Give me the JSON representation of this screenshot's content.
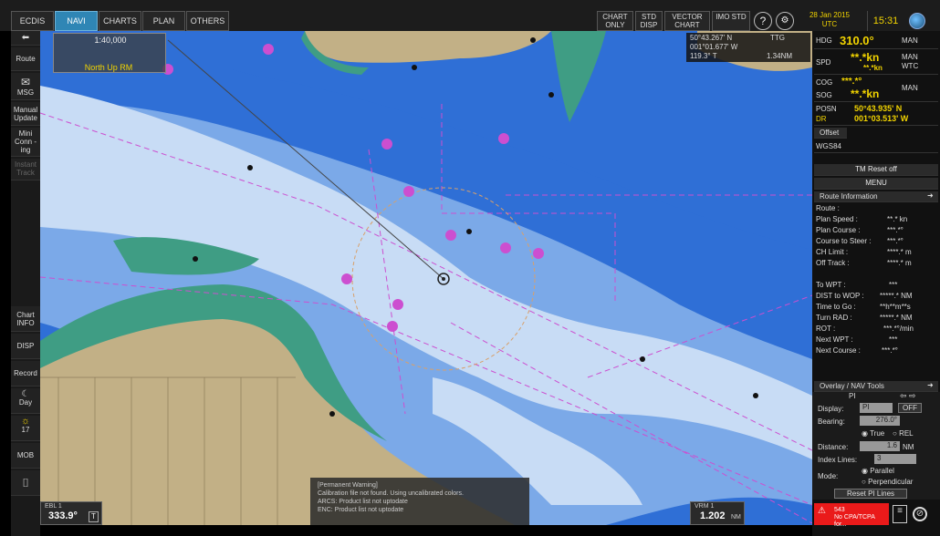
{
  "colors": {
    "deep": "#2f6fd6",
    "mid": "#7ba9e8",
    "shallow": "#c8dcf5",
    "land": "#c2b086",
    "drying": "#3f9d84",
    "symbol": "#cc4fd0",
    "accent": "#f2d400"
  },
  "tabs": [
    "ECDIS",
    "NAVI",
    "CHARTS",
    "PLAN",
    "OTHERS"
  ],
  "active_tab": "NAVI",
  "toolbar": {
    "chart_only": "CHART ONLY",
    "std_disp": "STD DISP",
    "vector_chart": "VECTOR CHART",
    "imo_std": "IMO STD",
    "help": "?",
    "date": "28 Jan 2015",
    "utc": "UTC",
    "time": "15:31"
  },
  "left": {
    "back": "⬅",
    "route": "Route",
    "msg": "MSG",
    "manual_update": "Manual Update",
    "mini_conning": "Mini Conn -ing",
    "instant_track": "Instant Track",
    "chart_info": "Chart INFO",
    "disp": "DISP",
    "record": "Record",
    "day": "Day",
    "brightness": "17",
    "mob": "MOB"
  },
  "chart": {
    "scale": "1:40,000",
    "orientation": "North Up RM",
    "target_lat": "50°43.267' N",
    "target_lon": "001°01.677' W",
    "target_brg": "119.3° T",
    "target_rng": "1.34NM",
    "ttg_label": "TTG"
  },
  "own_ship": {
    "hdg_label": "HDG",
    "hdg": "310.0°",
    "hdg_mode": "MAN",
    "spd_label": "SPD",
    "spd": "**.*kn",
    "spd_sub": "**.*kn",
    "spd_mode": "MAN WTC",
    "cog_label": "COG",
    "cog": "***.*°",
    "sog_label": "SOG",
    "sog": "**.*kn",
    "cog_mode": "MAN",
    "posn_label": "POSN",
    "dr_label": "DR",
    "lat": "50°43.935' N",
    "lon": "001°03.513' W",
    "offset_label": "Offset",
    "datum": "WGS84"
  },
  "panel": {
    "tm_reset": "TM Reset off",
    "menu": "MENU",
    "route_info_title": "Route Information",
    "route_label": "Route :",
    "plan_speed": "Plan Speed :",
    "plan_speed_v": "**.* kn",
    "plan_course": "Plan Course :",
    "plan_course_v": "***.*°",
    "course_to_steer": "Course to Steer :",
    "course_to_steer_v": "***.*°",
    "ch_limit": "CH Limit :",
    "ch_limit_v": "****.* m",
    "off_track": "Off Track :",
    "off_track_v": "****.* m",
    "to_wpt": "To WPT :",
    "to_wpt_v": "***",
    "dist_to_wop": "DIST to WOP :",
    "dist_to_wop_v": "*****.* NM",
    "time_to_go": "Time to Go :",
    "time_to_go_v": "**h**m**s",
    "turn_rad": "Turn RAD :",
    "turn_rad_v": "*****.* NM",
    "rot": "ROT :",
    "rot_v": "***.*°/min",
    "next_wpt": "Next WPT :",
    "next_wpt_v": "***",
    "next_course": "Next Course :",
    "next_course_v": "***.*°"
  },
  "overlay": {
    "title": "Overlay / NAV Tools",
    "pi": "PI",
    "display_label": "Display:",
    "display_value": "PI",
    "off_button": "OFF",
    "bearing_label": "Bearing:",
    "bearing_value": "276.0°",
    "true_label": "True",
    "rel_label": "REL",
    "distance_label": "Distance:",
    "distance_value": "1.6",
    "distance_unit": "NM",
    "index_lines_label": "Index Lines:",
    "index_lines_value": "3",
    "mode_label": "Mode:",
    "parallel": "Parallel",
    "perpendicular": "Perpendicular",
    "reset_button": "Reset PI Lines"
  },
  "bottom": {
    "ebl_label": "EBL 1",
    "ebl_value": "333.9°",
    "ebl_t": "T",
    "vrm_label": "VRM 1",
    "vrm_value": "1.202",
    "vrm_unit": "NM",
    "warning_title": "[Permanent Warning]",
    "warning_1": "Calibration file not found. Using uncalibrated colors.",
    "warning_2": "ARCS: Product list not uptodate",
    "warning_3": "ENC: Product list not uptodate",
    "alert_code": "543",
    "alert_text": "No CPA/TCPA for..."
  }
}
